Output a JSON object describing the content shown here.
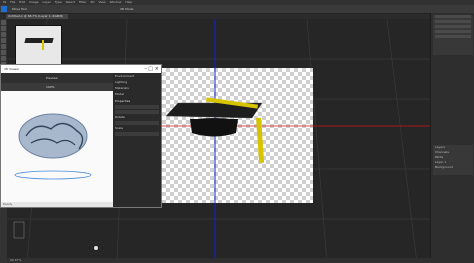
{
  "menubar": {
    "items": [
      "Ps",
      "File",
      "Edit",
      "Image",
      "Layer",
      "Type",
      "Select",
      "Filter",
      "3D",
      "View",
      "Window",
      "Help"
    ]
  },
  "optionsbar": {
    "tool_label": "Move Tool",
    "mode_label": "3D Mode"
  },
  "document_tab": {
    "title": "Untitled-1 @ 66.7% (Layer 1, RGB/8)"
  },
  "dialog": {
    "title": "3D Viewer",
    "preview_label": "Preview",
    "zoom_label": "100%",
    "status_text": "Ready",
    "panel_items": [
      "Environment",
      "Lighting",
      "Materials",
      "Model",
      "Rotate",
      "Scale"
    ],
    "panel_section": "Properties"
  },
  "right_panel": {
    "rows": [
      "Layers",
      "Channels",
      "Paths",
      "Layer 1",
      "Background"
    ]
  },
  "statusbar": {
    "text": "66.67%"
  },
  "colors": {
    "axis_red": "#d21010",
    "axis_blue": "#1020d0",
    "tassel": "#d6c400",
    "hat": "#1e1e1e"
  }
}
